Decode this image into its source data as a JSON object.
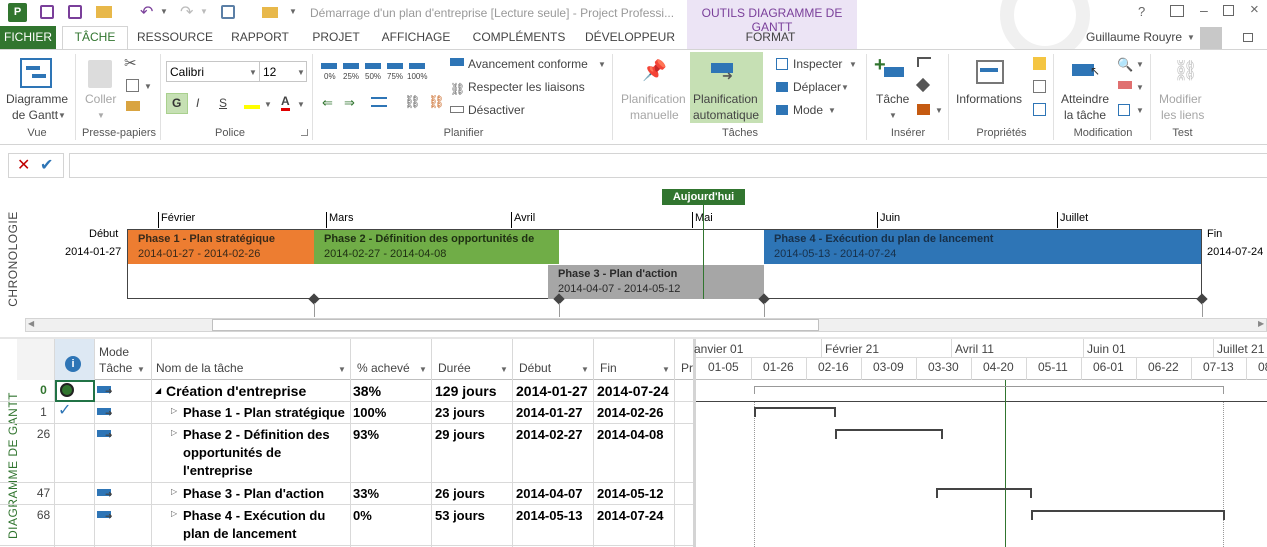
{
  "window": {
    "title": "Démarrage d'un plan d'entreprise [Lecture seule] - Project Professi...",
    "context_group": "OUTILS DIAGRAMME DE GANTT",
    "user": "Guillaume Rouyre"
  },
  "tabs": [
    "FICHIER",
    "TÂCHE",
    "RESSOURCE",
    "RAPPORT",
    "PROJET",
    "AFFICHAGE",
    "COMPLÉMENTS",
    "DÉVELOPPEUR",
    "FORMAT"
  ],
  "ribbon": {
    "vue": {
      "button": "Diagramme de Gantt",
      "button_line1": "Diagramme",
      "button_line2": "de Gantt",
      "group": "Vue"
    },
    "presse": {
      "coller": "Coller",
      "group": "Presse-papiers"
    },
    "police": {
      "font": "Calibri",
      "size": "12",
      "bold": "G",
      "italic": "I",
      "underline": "S",
      "group": "Police"
    },
    "planifier": {
      "pcts": [
        "0%",
        "25%",
        "50%",
        "75%",
        "100%"
      ],
      "avancement": "Avancement conforme",
      "respecter": "Respecter les liaisons",
      "desactiver": "Désactiver",
      "group": "Planifier"
    },
    "taches": {
      "manuelle_1": "Planification",
      "manuelle_2": "manuelle",
      "auto_1": "Planification",
      "auto_2": "automatique",
      "inspecter": "Inspecter",
      "deplacer": "Déplacer",
      "mode": "Mode",
      "group": "Tâches"
    },
    "inserer": {
      "tache": "Tâche",
      "group": "Insérer"
    },
    "proprietes": {
      "informations": "Informations",
      "group": "Propriétés"
    },
    "modification": {
      "atteindre_1": "Atteindre",
      "atteindre_2": "la tâche",
      "group": "Modification"
    },
    "test": {
      "modifier_1": "Modifier",
      "modifier_2": "les liens",
      "group": "Test"
    }
  },
  "formula": {
    "value": ""
  },
  "timeline": {
    "side_label": "CHRONOLOGIE",
    "today": "Aujourd'hui",
    "start_label": "Début",
    "start_date": "2014-01-27",
    "end_label": "Fin",
    "end_date": "2014-07-24",
    "months": [
      "Février",
      "Mars",
      "Avril",
      "Mai",
      "Juin",
      "Juillet"
    ],
    "phases": [
      {
        "name": "Phase 1 - Plan stratégique",
        "dates": "2014-01-27 - 2014-02-26",
        "color": "#ed7d31"
      },
      {
        "name": "Phase 2 - Définition des opportunités de",
        "dates": "2014-02-27 - 2014-04-08",
        "color": "#70ad47"
      },
      {
        "name": "Phase 3 - Plan d'action",
        "dates": "2014-04-07 - 2014-05-12",
        "color": "#a6a6a6"
      },
      {
        "name": "Phase 4 - Exécution du plan de lancement",
        "dates": "2014-05-13 - 2014-07-24",
        "color": "#2e75b6"
      }
    ]
  },
  "grid": {
    "side_label": "DIAGRAMME DE GANTT",
    "headers": {
      "mode_1": "Mode",
      "mode_2": "Tâche",
      "name": "Nom de la tâche",
      "pct": "% achevé",
      "duree": "Durée",
      "debut": "Début",
      "fin": "Fin",
      "pr": "Pr"
    },
    "rows": [
      {
        "id": "0",
        "name": "Création d'entreprise",
        "pct": "38%",
        "duree": "129 jours",
        "debut": "2014-01-27",
        "fin": "2014-07-24"
      },
      {
        "id": "1",
        "name": "Phase 1 - Plan stratégique",
        "pct": "100%",
        "duree": "23 jours",
        "debut": "2014-01-27",
        "fin": "2014-02-26"
      },
      {
        "id": "26",
        "name_l1": "Phase 2 - Définition des",
        "name_l2": "opportunités de",
        "name_l3": "l'entreprise",
        "pct": "93%",
        "duree": "29 jours",
        "debut": "2014-02-27",
        "fin": "2014-04-08"
      },
      {
        "id": "47",
        "name": "Phase 3 - Plan d'action",
        "pct": "33%",
        "duree": "26 jours",
        "debut": "2014-04-07",
        "fin": "2014-05-12"
      },
      {
        "id": "68",
        "name_l1": "Phase 4 - Exécution du",
        "name_l2": "plan de lancement",
        "pct": "0%",
        "duree": "53 jours",
        "debut": "2014-05-13",
        "fin": "2014-07-24"
      }
    ]
  },
  "gantt": {
    "top_scale": [
      "anvier 01",
      "Février 21",
      "Avril 11",
      "Juin 01",
      "Juillet 21"
    ],
    "bottom_scale": [
      "01-05",
      "01-26",
      "02-16",
      "03-09",
      "03-30",
      "04-20",
      "05-11",
      "06-01",
      "06-22",
      "07-13",
      "08"
    ]
  }
}
